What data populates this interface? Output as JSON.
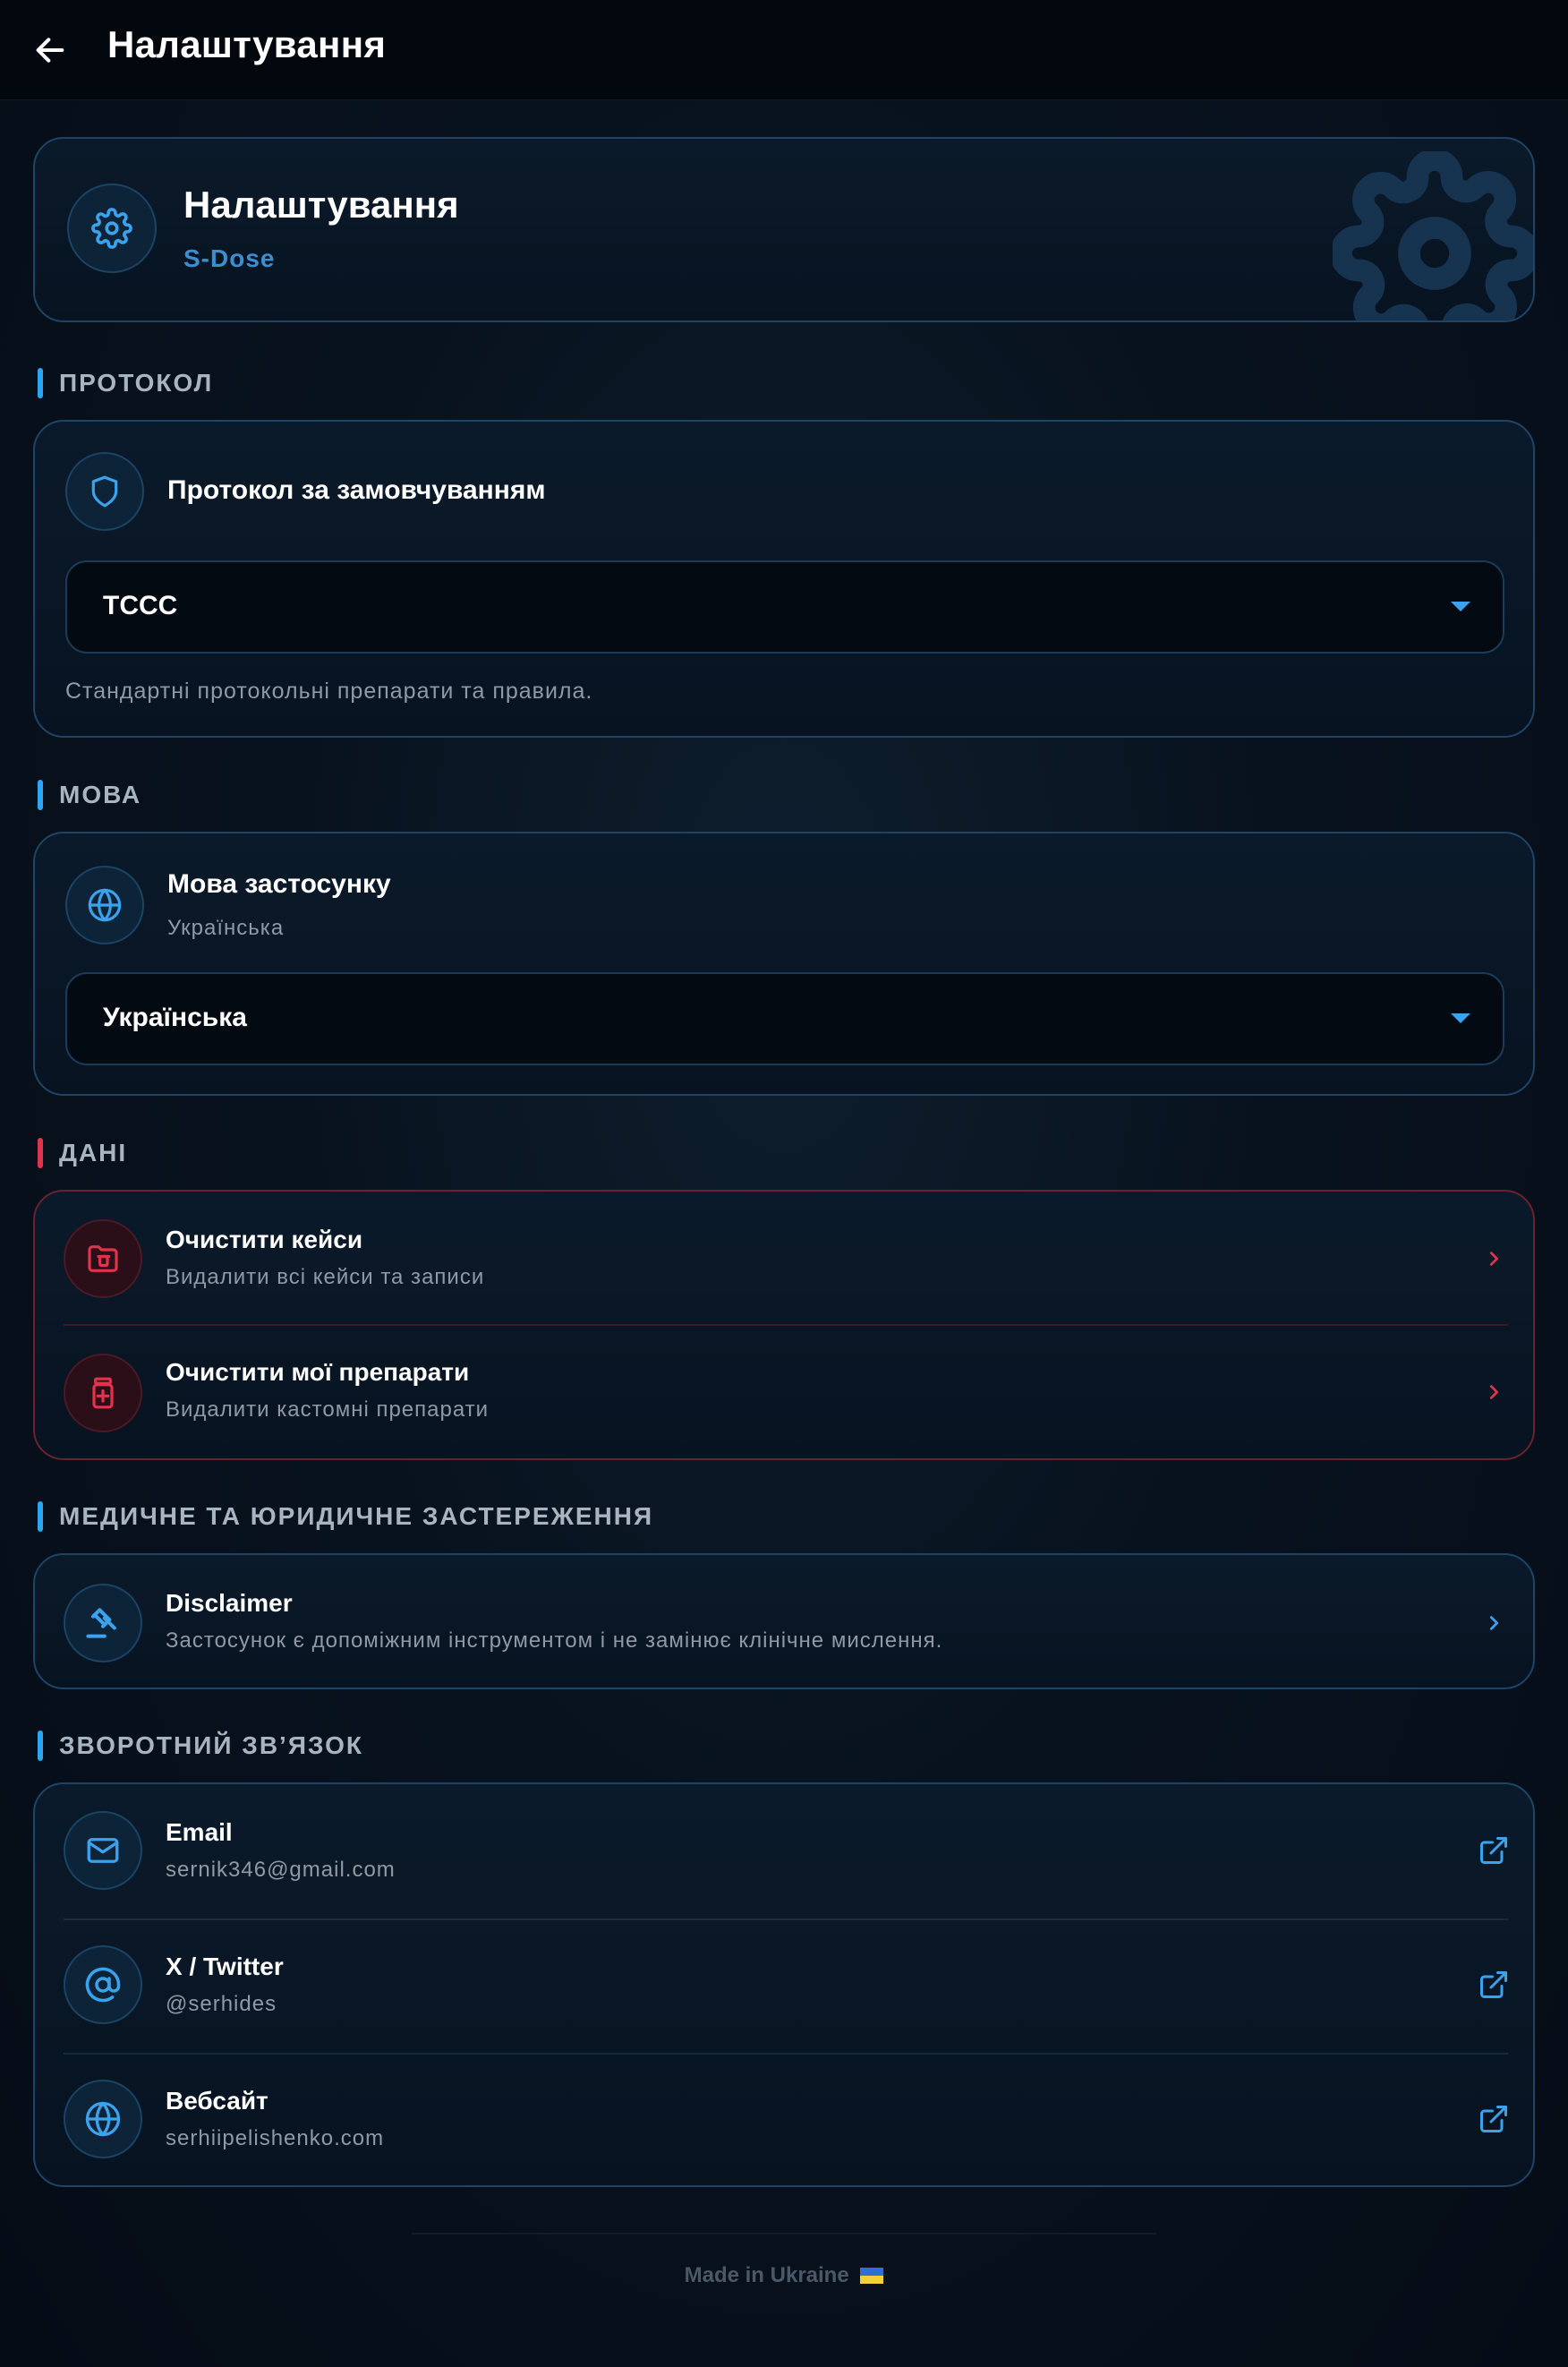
{
  "appbar": {
    "title": "Налаштування"
  },
  "header_card": {
    "title": "Налаштування",
    "subtitle": "S-Dose"
  },
  "sections": {
    "protocol": {
      "label": "ПРОТОКОЛ",
      "row_title": "Протокол за замовчуванням",
      "select_value": "TCCC",
      "description": "Стандартні протокольні препарати та правила."
    },
    "language": {
      "label": "МОВА",
      "row_title": "Мова застосунку",
      "row_sub": "Українська",
      "select_value": "Українська"
    },
    "data": {
      "label": "ДАНІ",
      "items": [
        {
          "title": "Очистити кейси",
          "subtitle": "Видалити всі кейси та записи"
        },
        {
          "title": "Очистити мої препарати",
          "subtitle": "Видалити кастомні препарати"
        }
      ]
    },
    "disclaimer": {
      "label": "МЕДИЧНЕ ТА ЮРИДИЧНЕ ЗАСТЕРЕЖЕННЯ",
      "title": "Disclaimer",
      "subtitle": "Застосунок є допоміжним інструментом і не замінює клінічне мислення."
    },
    "feedback": {
      "label": "ЗВОРОТНИЙ ЗВ’ЯЗОК",
      "items": [
        {
          "title": "Email",
          "subtitle": "sernik346@gmail.com"
        },
        {
          "title": "X / Twitter",
          "subtitle": "@serhides"
        },
        {
          "title": "Вебсайт",
          "subtitle": "serhiipelishenko.com"
        }
      ]
    }
  },
  "footer": {
    "text": "Made in Ukraine"
  },
  "colors": {
    "accent": "#3BA3EE",
    "danger": "#E0334C",
    "background": "#06101C",
    "card_border": "#1E4566"
  },
  "icons": {
    "back": "arrow-left-icon",
    "header": "gear-icon",
    "protocol": "shield-icon",
    "language": "globe-icon",
    "clear_cases": "folder-delete-icon",
    "clear_meds": "medicine-bottle-icon",
    "disclaimer": "gavel-icon",
    "email": "mail-icon",
    "twitter": "at-sign-icon",
    "website": "globe-icon",
    "chevron": "chevron-right-icon",
    "external": "external-link-icon"
  }
}
